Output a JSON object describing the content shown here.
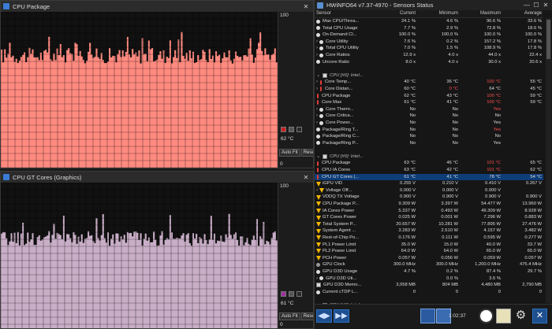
{
  "windows": {
    "cpu_package": {
      "title": "CPU Package",
      "max": "100",
      "min": "0",
      "current": "62 °C",
      "color": "#ff8a80",
      "swatch_colors": [
        "#cc2020",
        "#555555",
        "#2a2a2a"
      ],
      "fill_level": 0.72,
      "auto_fit": "Auto Fit",
      "reset": "Reset"
    },
    "gt_cores": {
      "title": "CPU GT Cores (Graphics)",
      "max": "100",
      "min": "0",
      "current": "61 °C",
      "color": "#c9aec7",
      "swatch_colors": [
        "#a0309c",
        "#555555",
        "#2a2a2a"
      ],
      "fill_level": 0.62,
      "auto_fit": "Auto Fit",
      "reset": "Reset"
    }
  },
  "hwinfo": {
    "title": "HWiNFO64 v7.37-4970 - Sensors Status",
    "headers": [
      "Sensor",
      "Current",
      "Minimum",
      "Maximum",
      "Average"
    ],
    "rows": [
      {
        "icon": "round",
        "name": "Max CPU/Threa...",
        "cur": "24.1 %",
        "min": "4.6 %",
        "max": "96.6 %",
        "avg": "33.6 %"
      },
      {
        "icon": "round",
        "name": "Total CPU Usage",
        "cur": "7.7 %",
        "min": "2.9 %",
        "max": "72.8 %",
        "avg": "18.6 %"
      },
      {
        "icon": "round",
        "name": "On-Demand Cl...",
        "cur": "100.0 %",
        "min": "100.0 %",
        "max": "100.0 %",
        "avg": "100.0 %"
      },
      {
        "icon": "round",
        "expand": true,
        "name": "Core Utility",
        "cur": "7.6 %",
        "min": "0.2 %",
        "max": "157.2 %",
        "avg": "17.8 %"
      },
      {
        "icon": "round",
        "expand": true,
        "name": "Total CPU Utility",
        "cur": "7.0 %",
        "min": "1.5 %",
        "max": "108.9 %",
        "avg": "17.8 %"
      },
      {
        "icon": "round",
        "expand": true,
        "name": "Core Ratios",
        "cur": "12.9 x",
        "min": "4.0 x",
        "max": "44.0 x",
        "avg": "22.4 x"
      },
      {
        "icon": "round",
        "name": "Uncore Ratio",
        "cur": "8.0 x",
        "min": "4.0 x",
        "max": "30.0 x",
        "avg": "20.6 x"
      },
      {
        "type": "spacer"
      },
      {
        "type": "group",
        "name": "CPU [#0]: Intel..."
      },
      {
        "icon": "therm",
        "expand": true,
        "name": "Core Temp...",
        "cur": "40 °C",
        "min": "36 °C",
        "max": "100 °C",
        "avg": "55 °C",
        "maxred": true
      },
      {
        "icon": "therm",
        "expand": true,
        "name": "Core Distan...",
        "cur": "60 °C",
        "min": "0 °C",
        "max": "64 °C",
        "avg": "45 °C",
        "minred": true
      },
      {
        "icon": "therm",
        "name": "CPU Package",
        "cur": "62 °C",
        "min": "43 °C",
        "max": "100 °C",
        "avg": "59 °C",
        "maxred": true
      },
      {
        "icon": "therm",
        "name": "Core Max",
        "cur": "61 °C",
        "min": "41 °C",
        "max": "100 °C",
        "avg": "59 °C",
        "maxred": true
      },
      {
        "icon": "round",
        "expand": true,
        "name": "Core Therm...",
        "cur": "No",
        "min": "No",
        "max": "Yes",
        "avg": "",
        "maxred": true
      },
      {
        "icon": "round",
        "expand": true,
        "name": "Core Critica...",
        "cur": "No",
        "min": "No",
        "max": "No",
        "avg": ""
      },
      {
        "icon": "round",
        "expand": true,
        "name": "Core Power...",
        "cur": "No",
        "min": "No",
        "max": "Yes",
        "avg": ""
      },
      {
        "icon": "round",
        "name": "Package/Ring T...",
        "cur": "No",
        "min": "No",
        "max": "Yes",
        "avg": "",
        "maxred": true
      },
      {
        "icon": "round",
        "name": "Package/Ring C...",
        "cur": "No",
        "min": "No",
        "max": "No",
        "avg": ""
      },
      {
        "icon": "round",
        "name": "Package/Ring P...",
        "cur": "No",
        "min": "No",
        "max": "Yes",
        "avg": ""
      },
      {
        "type": "spacer"
      },
      {
        "type": "group",
        "name": "CPU [#0]: Intel..."
      },
      {
        "icon": "therm",
        "name": "CPU Package",
        "cur": "63 °C",
        "min": "46 °C",
        "max": "101 °C",
        "avg": "65 °C",
        "maxred": true
      },
      {
        "icon": "therm",
        "name": "CPU IA Cores",
        "cur": "63 °C",
        "min": "42 °C",
        "max": "101 °C",
        "avg": "62 °C",
        "maxred": true
      },
      {
        "icon": "therm",
        "name": "CPU GT Cores (...",
        "cur": "61 °C",
        "min": "41 °C",
        "max": "78 °C",
        "avg": "54 °C",
        "sel": true
      },
      {
        "icon": "bolt",
        "name": "iGPU VID",
        "cur": "0.255 V",
        "min": "0.210 V",
        "max": "0.410 V",
        "avg": "0.267 V"
      },
      {
        "icon": "bolt",
        "expand": true,
        "name": "Voltage Off...",
        "cur": "0.000 V",
        "min": "0.000 V",
        "max": "0.000 V",
        "avg": ""
      },
      {
        "icon": "bolt",
        "name": "VDDQ TX Voltage",
        "cur": "0.900 V",
        "min": "0.900 V",
        "max": "0.900 V",
        "avg": "0.900 V"
      },
      {
        "icon": "bolt",
        "name": "CPU Package P...",
        "cur": "9.309 W",
        "min": "3.397 W",
        "max": "54.477 W",
        "avg": "13.960 W"
      },
      {
        "icon": "bolt",
        "name": "IA Cores Power",
        "cur": "5.337 W",
        "min": "0.493 W",
        "max": "49.309 W",
        "avg": "8.928 W"
      },
      {
        "icon": "bolt",
        "name": "GT Cores Power",
        "cur": "0.025 W",
        "min": "0.001 W",
        "max": "7.296 W",
        "avg": "0.883 W"
      },
      {
        "icon": "bolt",
        "name": "Total System P...",
        "cur": "20.657 W",
        "min": "10.281 W",
        "max": "77.895 W",
        "avg": "27.476 W"
      },
      {
        "icon": "bolt",
        "name": "System Agent ...",
        "cur": "3.283 W",
        "min": "2.510 W",
        "max": "4.157 W",
        "avg": "3.482 W"
      },
      {
        "icon": "bolt",
        "name": "Rest-of-Chip Po...",
        "cur": "0.176 W",
        "min": "0.111 W",
        "max": "0.595 W",
        "avg": "0.277 W"
      },
      {
        "icon": "bolt",
        "name": "PL1 Power Limit",
        "cur": "35.0 W",
        "min": "15.0 W",
        "max": "40.0 W",
        "avg": "33.7 W"
      },
      {
        "icon": "bolt",
        "name": "PL2 Power Limit",
        "cur": "64.0 W",
        "min": "64.0 W",
        "max": "65.0 W",
        "avg": "65.0 W"
      },
      {
        "icon": "bolt",
        "name": "PCH Power",
        "cur": "0.057 W",
        "min": "0.056 W",
        "max": "0.059 W",
        "avg": "0.057 W"
      },
      {
        "icon": "freq",
        "name": "GPU Clock",
        "cur": "300.0 MHz",
        "min": "300.0 MHz",
        "max": "1,200.0 MHz",
        "avg": "475.4 MHz"
      },
      {
        "icon": "round",
        "name": "GPU D3D Usage",
        "cur": "4.7 %",
        "min": "0.2 %",
        "max": "87.4 %",
        "avg": "29.7 %"
      },
      {
        "icon": "round",
        "expand": true,
        "name": "GPU D3D Uti...",
        "cur": "",
        "min": "0.0 %",
        "max": "3.6 %",
        "avg": ""
      },
      {
        "icon": "chip",
        "name": "GPU D3D Memo...",
        "cur": "3,058 MB",
        "min": "804 MB",
        "max": "4,480 MB",
        "avg": "2,790 MB"
      },
      {
        "icon": "round",
        "name": "Current cTDP L...",
        "cur": "0",
        "min": "0",
        "max": "0",
        "avg": "0"
      },
      {
        "type": "spacer"
      },
      {
        "type": "group",
        "name": "CPU [#0]: Intel..."
      }
    ],
    "time": "1:02:37"
  }
}
